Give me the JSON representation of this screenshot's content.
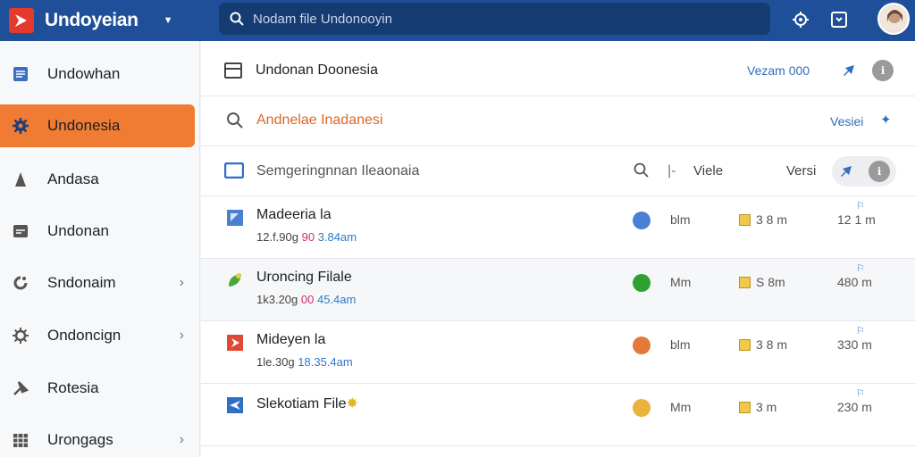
{
  "app": {
    "name": "Undoyeian",
    "search_placeholder": "Nodam file Undonooyin"
  },
  "sidebar": {
    "items": [
      {
        "label": "Undowhan"
      },
      {
        "label": "Undonesia"
      },
      {
        "label": "Andasa"
      },
      {
        "label": "Undonan"
      },
      {
        "label": "Sndonaim"
      },
      {
        "label": "Ondoncign"
      },
      {
        "label": "Rotesia"
      },
      {
        "label": "Urongags"
      }
    ]
  },
  "main": {
    "header_title": "Undonan Doonesia",
    "header_version": "Vezam 000",
    "search_text": "Andnelae Inadanesi",
    "search_link": "Vesiei",
    "filter_text": "Semgeringnnan Ileaonaia",
    "col_visible": "Viele",
    "col_versi": "Versi",
    "files": [
      {
        "name": "Madeeria la",
        "meta_a": "12.f.90g",
        "meta_b": "90",
        "meta_c": "3.84am",
        "status_color": "#4a7fd6",
        "col1": "blm",
        "col2": "3 8 m",
        "col3": "12 1 m"
      },
      {
        "name": "Uroncing Filale",
        "meta_a": "1k3.20g",
        "meta_b": "00",
        "meta_c": "45.4am",
        "status_color": "#2ea12e",
        "col1": "Mm",
        "col2": "S 8m",
        "col3": "480 m"
      },
      {
        "name": "Mideyen la",
        "meta_a": "1le.30g",
        "meta_b": "18.",
        "meta_c": "35.4am",
        "status_color": "#e37a3a",
        "col1": "blm",
        "col2": "3 8 m",
        "col3": "330 m"
      },
      {
        "name": "Slekotiam File",
        "meta_a": "",
        "meta_b": "",
        "meta_c": "",
        "status_color": "#e9b43b",
        "col1": "Mm",
        "col2": "3 m",
        "col3": "230 m"
      }
    ]
  }
}
